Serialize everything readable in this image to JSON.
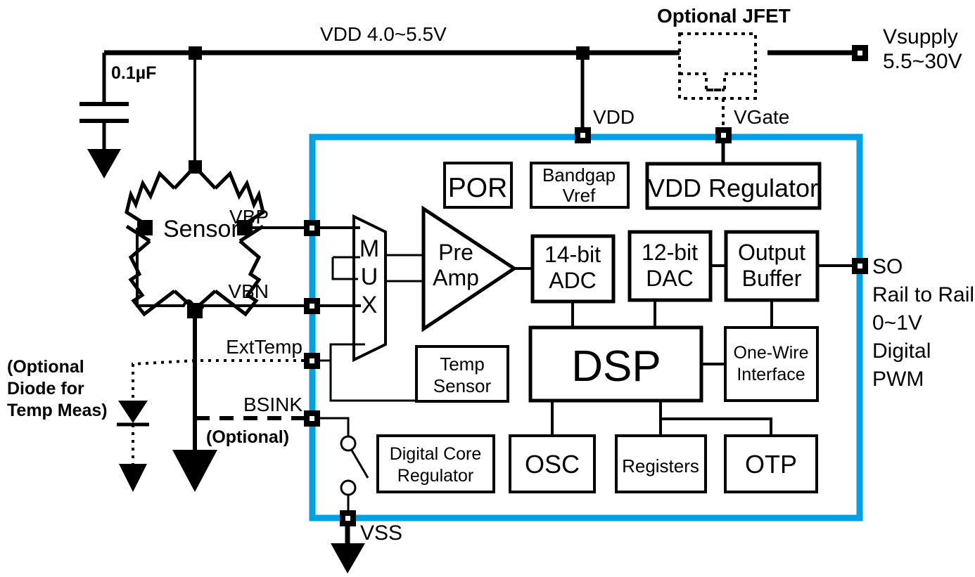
{
  "diagram": {
    "title_note_jfet": "Optional JFET",
    "colors": {
      "chip_border": "#00A0E4",
      "wire": "#000000",
      "background": "#FFFFFF"
    }
  },
  "external": {
    "cap_label": "0.1µF",
    "vdd_rail_label": "VDD  4.0~5.5V",
    "vsupply_line1": "Vsupply",
    "vsupply_line2": "5.5~30V",
    "jfet_label": "Optional JFET",
    "sensor_label": "Sensor",
    "diode_note_line1": "(Optional",
    "diode_note_line2": "Diode for",
    "diode_note_line3": "Temp Meas)",
    "bsink_optional_note": "(Optional)"
  },
  "pins": [
    {
      "name": "VDD",
      "label": "VDD"
    },
    {
      "name": "VGate",
      "label": "VGate"
    },
    {
      "name": "VBP",
      "label": "VBP"
    },
    {
      "name": "VBN",
      "label": "VBN"
    },
    {
      "name": "ExtTemp",
      "label": "ExtTemp"
    },
    {
      "name": "BSINK",
      "label": "BSINK"
    },
    {
      "name": "VSS",
      "label": "VSS"
    },
    {
      "name": "SO",
      "label": "SO"
    }
  ],
  "output_notes": {
    "l1": "SO",
    "l2": "Rail to Rail",
    "l3": "0~1V",
    "l4": "Digital",
    "l5": "PWM"
  },
  "blocks": {
    "por": "POR",
    "bandgap_l1": "Bandgap",
    "bandgap_l2": "Vref",
    "vdd_regulator": "VDD Regulator",
    "mux_l1": "M",
    "mux_l2": "U",
    "mux_l3": "X",
    "preamp_l1": "Pre",
    "preamp_l2": "Amp",
    "adc_l1": "14-bit",
    "adc_l2": "ADC",
    "dac_l1": "12-bit",
    "dac_l2": "DAC",
    "outbuf_l1": "Output",
    "outbuf_l2": "Buffer",
    "tempsensor_l1": "Temp",
    "tempsensor_l2": "Sensor",
    "dsp": "DSP",
    "onewire_l1": "One-Wire",
    "onewire_l2": "Interface",
    "digcore_l1": "Digital Core",
    "digcore_l2": "Regulator",
    "osc": "OSC",
    "registers": "Registers",
    "otp": "OTP"
  }
}
